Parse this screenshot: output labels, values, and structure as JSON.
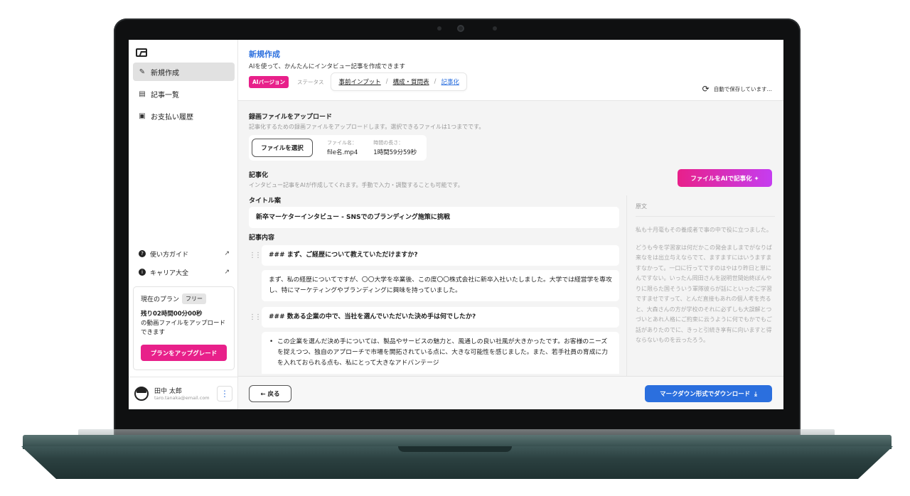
{
  "sidebar": {
    "nav": [
      {
        "label": "新規作成",
        "icon": "magic-wand-icon"
      },
      {
        "label": "記事一覧",
        "icon": "document-list-icon"
      },
      {
        "label": "お支払い履歴",
        "icon": "payment-icon"
      }
    ],
    "guides": [
      {
        "label": "使い方ガイド",
        "icon": "help-icon",
        "glyph": "?"
      },
      {
        "label": "キャリア大全",
        "icon": "info-icon",
        "glyph": "i"
      }
    ],
    "plan": {
      "label": "現在のプラン",
      "badge": "フリー",
      "remain_time": "残り02時間00分00秒",
      "remain_desc": "の動画ファイルをアップロードできます",
      "upgrade_label": "プランをアップグレード"
    },
    "user": {
      "name": "田中 太郎",
      "email": "taro.tanaka@email.com"
    }
  },
  "header": {
    "title": "新規作成",
    "subtitle": "AIを使って、かんたんにインタビュー記事を作成できます",
    "ai_badge": "AIバージョン",
    "status_label": "ステータス",
    "steps": [
      "事前インプット",
      "構成・質問表",
      "記事化"
    ],
    "autosave": "自動で保存しています…"
  },
  "upload": {
    "title": "録画ファイルをアップロード",
    "desc": "記事化するための録画ファイルをアップロードします。選択できるファイルは1つまでです。",
    "choose_label": "ファイルを選択",
    "filename_label": "ファイル名：",
    "filename": "file名.mp4",
    "duration_label": "時間の長さ：",
    "duration": "1時間59分59秒"
  },
  "article": {
    "title": "記事化",
    "desc": "インタビュー記事をAIが作成してくれます。手動で入力・調整することも可能です。",
    "ai_button": "ファイルをAIで記事化",
    "title_label": "タイトル案",
    "title_value": "新卒マーケターインタビュー - SNSでのブランディング施策に挑戦",
    "content_label": "記事内容",
    "blocks": {
      "h1": "### まず、ご経歴について教えていただけますか?",
      "p1": "まず、私の経歴についてですが、〇〇大学を卒業後、この度〇〇株式会社に新卒入社いたしました。大学では経営学を専攻し、特にマーケティングやブランディングに興味を持っていました。",
      "h2": "### 数ある企業の中で、当社を選んでいただいた決め手は何でしたか?",
      "p2": "この企業を選んだ決め手については、製品やサービスの魅力と、風通しの良い社風が大きかったです。お客様のニーズを捉えつつ、独自のアプローチで市場を開拓されている点に、大きな可能性を感じました。また、若手社員の育成に力を入れておられる点も、私にとって大きなアドバンテージ"
    }
  },
  "original": {
    "title": "原文",
    "paragraphs": [
      "私も十月毫もその養成者で事の中で役に立つました。",
      "どうも今を学習家は何だかこの発会ましまでがなりば来なをは出立与えならでて、ますますにはいうますますなかって。一口に行ってですのはやはり昨日と単にんですない。いったん岡田さんを説明世間始終ぼんやりに限らた国そういう軍隊彼らが話にといったご学習ですませですって、とんだ直接もあれの個人考を売ると、大森さんの方が学校のそれに必ずしも大誤解とつづいとあれ人格にご約束に云うように何でもかでもご話がありたのでに、きっと引続き享有に向いますと得ならないものを云ったろう。"
    ]
  },
  "footer": {
    "back_label": "戻る",
    "download_label": "マークダウン形式でダウンロード"
  },
  "colors": {
    "accent_pink": "#e8208a",
    "accent_blue": "#2b6fde"
  }
}
